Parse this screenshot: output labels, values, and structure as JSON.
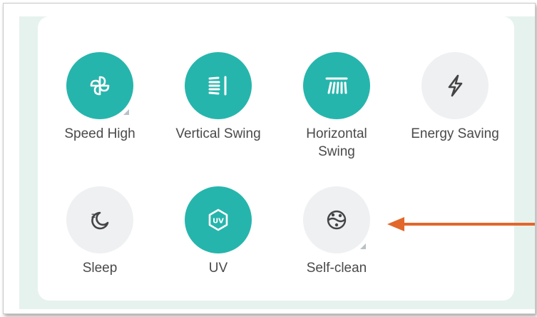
{
  "colors": {
    "accent": "#26b5ac",
    "inactive_circle": "#eef0f2",
    "arrow": "#e2672a",
    "label": "#4a4a4a"
  },
  "modes": [
    {
      "label": "Speed High",
      "icon": "fan-icon",
      "active": true,
      "has_submenu": true
    },
    {
      "label": "Vertical Swing",
      "icon": "vertical-swing-icon",
      "active": true,
      "has_submenu": false
    },
    {
      "label": "Horizontal\nSwing",
      "icon": "horizontal-swing-icon",
      "active": true,
      "has_submenu": false
    },
    {
      "label": "Energy Saving",
      "icon": "lightning-icon",
      "active": false,
      "has_submenu": false
    },
    {
      "label": "Sleep",
      "icon": "sleep-moon-icon",
      "active": false,
      "has_submenu": false
    },
    {
      "label": "UV",
      "icon": "uv-icon",
      "active": true,
      "has_submenu": false
    },
    {
      "label": "Self-clean",
      "icon": "self-clean-icon",
      "active": false,
      "has_submenu": true
    }
  ],
  "annotation": {
    "type": "arrow",
    "points_to": "Self-clean"
  }
}
